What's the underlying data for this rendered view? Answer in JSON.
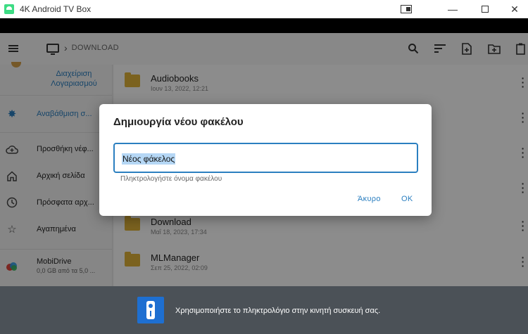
{
  "window": {
    "title": "4K Android TV Box",
    "icons": [
      "app-icon",
      "cast-icon",
      "minimize-icon",
      "maximize-icon",
      "close-icon"
    ]
  },
  "toolbar": {
    "breadcrumb": "DOWNLOAD",
    "icons": [
      "menu-icon",
      "tv-icon",
      "search-icon",
      "sort-icon",
      "new-file-icon",
      "new-folder-icon",
      "clipboard-icon"
    ]
  },
  "sidebar": {
    "account_link": "Διαχείριση Λογαριασμού",
    "items": [
      {
        "label": "Αναβάθμιση σ...",
        "icon": "premium-badge-icon",
        "highlight": true
      },
      {
        "label": "Προσθήκη νέφ...",
        "icon": "cloud-add-icon"
      },
      {
        "label": "Αρχική σελίδα",
        "icon": "home-icon"
      },
      {
        "label": "Πρόσφατα αρχ...",
        "icon": "clock-icon"
      },
      {
        "label": "Αγαπημένα",
        "icon": "star-icon"
      }
    ],
    "mobidrive": {
      "label": "MobiDrive",
      "storage": "0,0 GB από τα 5,0 ..."
    }
  },
  "files": [
    {
      "name": "Audiobooks",
      "date": "Ιουν 13, 2022, 12:21"
    },
    {
      "name": "Download",
      "date": "Μαΐ 18, 2023, 17:34"
    },
    {
      "name": "MLManager",
      "date": "Σεπ 25, 2022, 02:09"
    }
  ],
  "dialog": {
    "title": "Δημιουργία νέου φακέλου",
    "input_value": "Νέος φάκελος",
    "helper": "Πληκτρολογήστε όνομα φακέλου",
    "cancel_label": "Άκυρο",
    "ok_label": "OK"
  },
  "bottom_bar": {
    "message": "Χρησιμοποιήστε το πληκτρολόγιο στην κινητή συσκευή σας.",
    "accent": "#1e6fd1"
  },
  "colors": {
    "accent": "#2b7fc0",
    "folder": "#e1b23a"
  }
}
